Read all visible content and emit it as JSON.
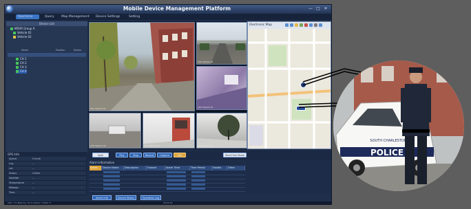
{
  "window": {
    "title": "Mobile Device Management Platform",
    "controls": {
      "minimize": "—",
      "maximize": "□",
      "close": "✕"
    }
  },
  "menu": {
    "items": [
      "Real-time",
      "Query",
      "Map Management",
      "Device Settings",
      "Setting"
    ]
  },
  "left_panel": {
    "header": "Device List",
    "tree": [
      "MDVR Group A",
      "Vehicle 01",
      "Vehicle 02",
      "CH 1",
      "CH 2",
      "CH 3",
      "CH 4"
    ],
    "grid_headers": [
      "Name",
      "Position",
      "Status"
    ]
  },
  "info_panel": {
    "title": "GPS Info",
    "rows": [
      {
        "key": "Speed",
        "value": "0 km/h"
      },
      {
        "key": "Lng",
        "value": "--"
      },
      {
        "key": "Lat",
        "value": "--"
      },
      {
        "key": "Status",
        "value": "Online"
      },
      {
        "key": "Satellite",
        "value": "--"
      },
      {
        "key": "Temperature",
        "value": "--"
      },
      {
        "key": "Mileage",
        "value": "--"
      },
      {
        "key": "Time",
        "value": "--"
      }
    ]
  },
  "videos": [
    {
      "caption": "CH1 Vehicle 01"
    },
    {
      "caption": "CH2 Vehicle 01"
    },
    {
      "caption": "CH3 Vehicle 01"
    },
    {
      "caption": "CH4 Vehicle 02"
    },
    {
      "caption": "CH5 Vehicle 02"
    },
    {
      "caption": "CH6 Vehicle 02"
    }
  ],
  "map": {
    "title": "Electronic Map",
    "marker_label": "Vehicle 01"
  },
  "controls": {
    "buttons": [
      "Split",
      "Play",
      "Stop",
      "Record",
      "Capture",
      "Talk"
    ],
    "right_select": "Real-Time Mode"
  },
  "alarm_panel": {
    "title": "Alarm Information",
    "columns": [
      "Name",
      "Device Name",
      "Description",
      "Channel",
      "Alarm Time",
      "Time Period",
      "Handle",
      "Other"
    ],
    "row_count": 6
  },
  "bottom_buttons": [
    "Alarm Info",
    "Device Status",
    "Operation Log"
  ],
  "status": {
    "text": "CPU: 1 %   Memory: 32 %   Online: 3   Total: 5",
    "time": "16:21:40"
  },
  "photo": {
    "car_text": "POLICE",
    "car_subtext": "SOUTH CHARLESTON"
  },
  "colors": {
    "app_bg": "#1f2e49",
    "accent": "#3a75c8",
    "canvas": "#5e5e5e"
  }
}
